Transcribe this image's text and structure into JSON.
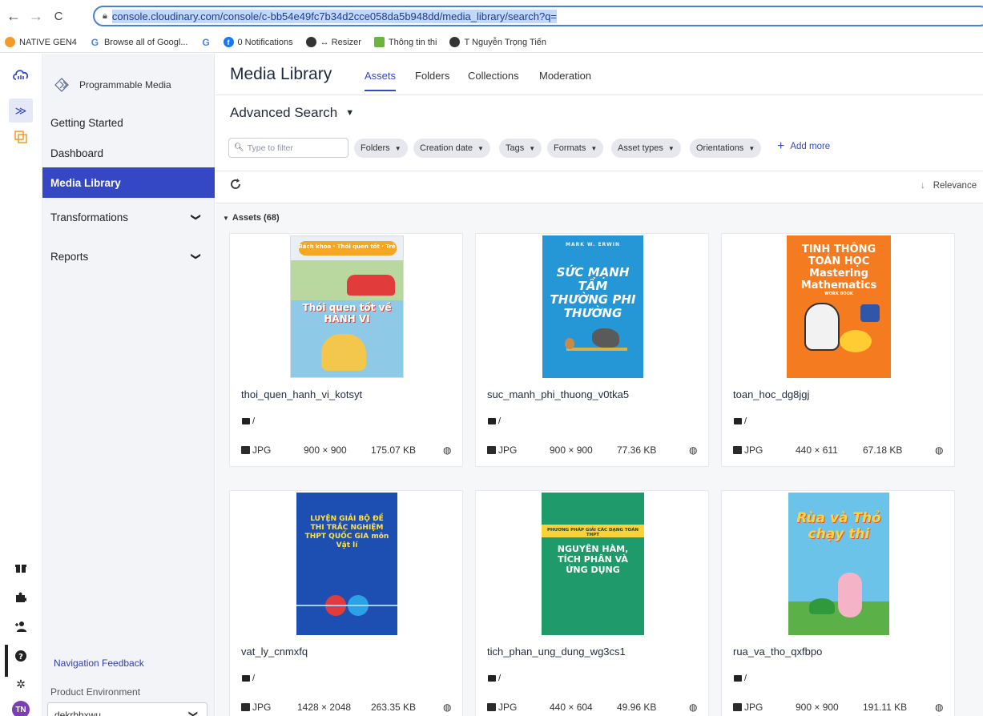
{
  "browser": {
    "url": "console.cloudinary.com/console/c-bb54e49fc7b34d2cce058da5b948dd/media_library/search?q=",
    "bookmarks": [
      {
        "label": "NATIVE GEN4",
        "icon": "native-gen4-icon",
        "color": "#f29b2a"
      },
      {
        "label": "Browse all of Googl...",
        "icon": "google-icon",
        "color": "#4285f4"
      },
      {
        "label": "",
        "icon": "google-icon",
        "color": "#4285f4"
      },
      {
        "label": "0 Notifications",
        "icon": "facebook-icon",
        "color": "#1877f2"
      },
      {
        "label": "↔ Resizer",
        "icon": "globe-icon",
        "color": "#333333"
      },
      {
        "label": "Thông tin thi",
        "icon": "leaf-icon",
        "color": "#6bb342"
      },
      {
        "label": "T Nguyễn Trọng Tiến",
        "icon": "globe-icon",
        "color": "#333333"
      }
    ]
  },
  "sidebar": {
    "brand": "Programmable Media",
    "items": [
      {
        "label": "Getting Started",
        "active": false,
        "expandable": false
      },
      {
        "label": "Dashboard",
        "active": false,
        "expandable": false
      },
      {
        "label": "Media Library",
        "active": true,
        "expandable": false
      },
      {
        "label": "Transformations",
        "active": false,
        "expandable": true
      },
      {
        "label": "Reports",
        "active": false,
        "expandable": true
      }
    ],
    "feedback": "Navigation Feedback",
    "env_label": "Product Environment",
    "env_value": "dekrbhxwu"
  },
  "header": {
    "title": "Media Library",
    "tabs": [
      "Assets",
      "Folders",
      "Collections",
      "Moderation"
    ],
    "active_tab": "Assets"
  },
  "search": {
    "title": "Advanced Search",
    "placeholder": "Type to filter",
    "filters": [
      "Folders",
      "Creation date",
      "Tags",
      "Formats",
      "Asset types",
      "Orientations"
    ],
    "add_more": "Add more"
  },
  "toolbar": {
    "sort_label": "Relevance"
  },
  "assets": {
    "header": "Assets (68)",
    "items": [
      {
        "name": "thoi_quen_hanh_vi_kotsyt",
        "folder": "/",
        "format": "JPG",
        "dims": "900 × 900",
        "size": "175.07 KB",
        "cover_title": "Thói quen tốt về HÀNH VI",
        "cover_top": "Bách khoa · Thói quen tốt · Trẻ",
        "cover_bg": "#e9eff5",
        "cover_fg": "#ffffff"
      },
      {
        "name": "suc_manh_phi_thuong_v0tka5",
        "folder": "/",
        "format": "JPG",
        "dims": "900 × 900",
        "size": "77.36 KB",
        "cover_title": "SỨC MẠNH TẦM THƯỜNG PHI THƯỜNG",
        "cover_top": "MARK W. ERWIN",
        "cover_bg": "#2596d6",
        "cover_fg": "#ffffff"
      },
      {
        "name": "toan_hoc_dg8jgj",
        "folder": "/",
        "format": "JPG",
        "dims": "440 × 611",
        "size": "67.18 KB",
        "cover_title": "TINH THÔNG TOÁN HỌC Mastering Mathematics",
        "cover_top": "WORK BOOK",
        "cover_bg": "#f47b20",
        "cover_fg": "#ffffff"
      },
      {
        "name": "vat_ly_cnmxfq",
        "folder": "/",
        "format": "JPG",
        "dims": "1428 × 2048",
        "size": "263.35 KB",
        "cover_title": "LUYỆN GIẢI BỘ ĐỀ THI TRẮC NGHIỆM THPT QUỐC GIA môn Vật lí",
        "cover_top": "",
        "cover_bg": "#1d4fb2",
        "cover_fg": "#ffe14a"
      },
      {
        "name": "tich_phan_ung_dung_wg3cs1",
        "folder": "/",
        "format": "JPG",
        "dims": "440 × 604",
        "size": "49.96 KB",
        "cover_title": "NGUYÊN HÀM, TÍCH PHÂN VÀ ỨNG DỤNG",
        "cover_top": "PHƯƠNG PHÁP GIẢI CÁC DẠNG TOÁN THPT",
        "cover_bg": "#1f9b6b",
        "cover_fg": "#ffffff"
      },
      {
        "name": "rua_va_tho_qxfbpo",
        "folder": "/",
        "format": "JPG",
        "dims": "900 × 900",
        "size": "191.11 KB",
        "cover_title": "Rùa và Thỏ chạy thi",
        "cover_top": "",
        "cover_bg": "#6bc3ea",
        "cover_fg": "#ffd23f"
      }
    ]
  },
  "colors": {
    "accent": "#3448c5",
    "url_highlight": "#c3d7f7"
  }
}
